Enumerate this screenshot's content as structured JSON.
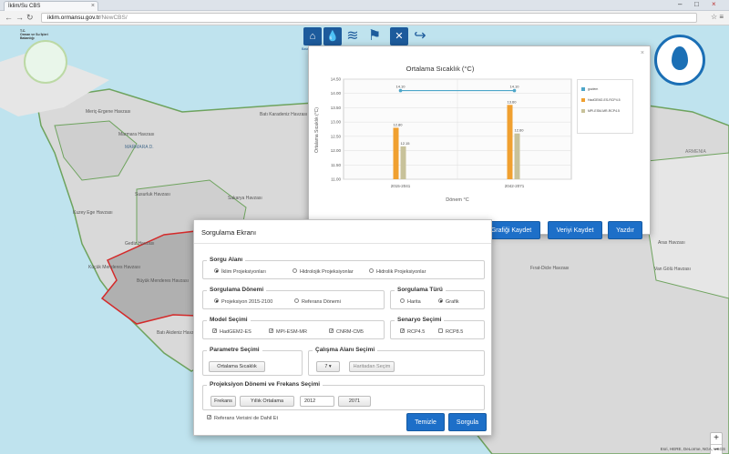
{
  "browser": {
    "tab_title": "İklim/Su CBS",
    "url_host": "iklim.ormansu.gov.tr",
    "url_path": "/NewCBS/"
  },
  "logo_left": {
    "line1": "T.C.",
    "line2": "Orman ve Su İşleri",
    "line3": "Bakanlığı"
  },
  "map_labels": [
    "Meriç-Ergene Havzası",
    "Marmara Havzası",
    "MARMARA D.",
    "Sakarya Havzası",
    "Batı Karadeniz Havzası",
    "Susurluk Havzası",
    "Kuzey Ege Havzası",
    "Gediz Havzası",
    "Küçük Menderes Havzası",
    "Büyük Menderes Havzası",
    "Batı Akdeniz Havzası",
    "Aras Havzası",
    "Fırat-Dicle Havzası",
    "ARMENIA",
    "Van Gölü Havzası"
  ],
  "toolbar": [
    {
      "label": "Baseplanlar",
      "glyph": "⌂",
      "icon": "basemap-icon"
    },
    {
      "label": "Su Kaynakları",
      "glyph": "💧",
      "icon": "water-resources-icon"
    },
    {
      "label": "Katmanlar",
      "glyph": "≋",
      "icon": "layers-icon"
    },
    {
      "label": "Sorgu",
      "glyph": "⚑",
      "icon": "query-icon"
    },
    {
      "label": "Araçlar",
      "glyph": "✕",
      "icon": "tools-icon"
    },
    {
      "label": "Çıkış",
      "glyph": "↪",
      "icon": "logout-icon"
    }
  ],
  "chart_window": {
    "save_chart": "Grafiği Kaydet",
    "save_data": "Veriyi Kaydet",
    "print": "Yazdır"
  },
  "chart_data": {
    "type": "bar",
    "title": "Ortalama Sıcaklık (°C)",
    "xlabel": "Dönem °C",
    "ylabel": "Ortalama Sıcaklık (°C)",
    "ylim": [
      11.0,
      14.5
    ],
    "yticks": [
      "14.50",
      "14.00",
      "13.50",
      "13.00",
      "12.50",
      "12.00",
      "11.50",
      "11.00"
    ],
    "categories": [
      "2015-2041",
      "2042-2071"
    ],
    "series": [
      {
        "name": "gozlem",
        "type": "line",
        "values": [
          14.1,
          14.1
        ],
        "color": "#4da6c9"
      },
      {
        "name": "HadGEM2-ES-RCP4.5",
        "type": "bar",
        "values": [
          12.8,
          13.6
        ],
        "color": "#f0a030"
      },
      {
        "name": "MPI-ESM-MR-RCP4.5",
        "type": "bar",
        "values": [
          12.15,
          12.6
        ],
        "color": "#c8c29a"
      }
    ],
    "data_labels": [
      "14.10",
      "14.10",
      "12.80",
      "13.60",
      "12.15",
      "12.60"
    ]
  },
  "query": {
    "title": "Sorgulama Ekranı",
    "area": {
      "legend": "Sorgu Alanı",
      "options": [
        "İklim Projeksiyonları",
        "Hidrolojik Projeksiyonlar",
        "Hidrolik Projeksiyonlar"
      ],
      "selected": 0
    },
    "period": {
      "legend": "Sorgulama Dönemi",
      "options": [
        "Projeksiyon 2015-2100",
        "Referans Dönemi"
      ],
      "selected": 0
    },
    "qtype": {
      "legend": "Sorgulama Türü",
      "options": [
        "Harita",
        "Grafik"
      ],
      "selected": 1
    },
    "model": {
      "legend": "Model Seçimi",
      "options": [
        "HadGEM2-ES",
        "MPI-ESM-MR",
        "CNRM-CM5"
      ],
      "checked": [
        true,
        true,
        true
      ]
    },
    "scenario": {
      "legend": "Senaryo Seçimi",
      "options": [
        "RCP4.5",
        "RCP8.5"
      ],
      "checked": [
        true,
        false
      ]
    },
    "param": {
      "legend": "Parametre Seçimi",
      "button": "Ortalama Sıcaklık"
    },
    "work_area": {
      "legend": "Çalışma Alanı Seçimi",
      "select": "7 ▾",
      "button": "Haritadan Seçim"
    },
    "proj": {
      "legend": "Projeksiyon Dönemi ve Frekans Seçimi",
      "freq_label": "Frekans",
      "freq_value": "Yıllık Ortalama",
      "start": "2012",
      "end": "2071"
    },
    "reference_check": "Referans Verisini de Dahil Et",
    "clear": "Temizle",
    "submit": "Sorgula"
  },
  "zoom": {
    "in": "+",
    "out": "−"
  },
  "attribution": "Esri, HERE, DeLorme, NGA, USGS"
}
